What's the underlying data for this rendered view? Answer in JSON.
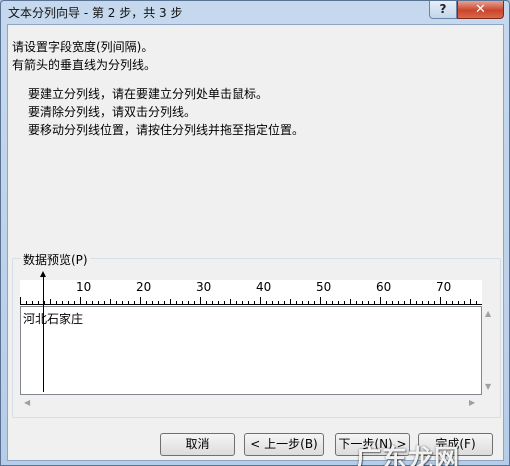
{
  "window": {
    "title": "文本分列向导 - 第 2 步，共 3 步",
    "help_label": "?",
    "close_label": "✕"
  },
  "instructions": {
    "line1": "请设置字段宽度(列间隔)。",
    "line2": "有箭头的垂直线为分列线。",
    "bullets": [
      "要建立分列线，请在要建立分列处单击鼠标。",
      "要清除分列线，请双击分列线。",
      "要移动分列线位置，请按住分列线并拖至指定位置。"
    ]
  },
  "preview": {
    "label": "数据预览(P)",
    "ruler_labels": [
      "10",
      "20",
      "30",
      "40",
      "50",
      "60",
      "70"
    ],
    "rows": [
      "河北石家庄"
    ],
    "column_break_at": 4
  },
  "buttons": {
    "cancel": "取消",
    "back": "< 上一步(B)",
    "next": "下一步(N) >",
    "finish": "完成(F)"
  },
  "watermark": "广东龙网"
}
